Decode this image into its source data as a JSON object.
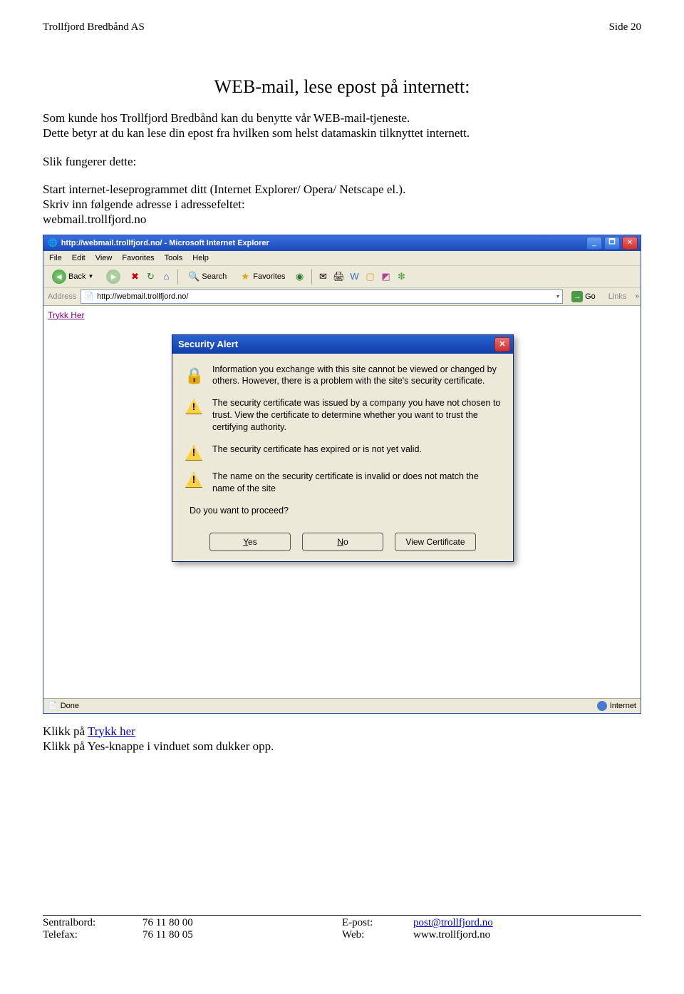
{
  "header": {
    "left": "Trollfjord Bredbånd AS",
    "right": "Side 20"
  },
  "title": "WEB-mail, lese epost på internett:",
  "paragraphs": {
    "intro": "Som kunde hos Trollfjord Bredbånd kan du benytte vår WEB-mail-tjeneste.\nDette betyr at du kan lese din epost fra hvilken som helst datamaskin tilknyttet internett.",
    "sub": "Slik fungerer dette:",
    "instr1": "Start internet-leseprogrammet ditt (Internet Explorer/ Opera/ Netscape el.).",
    "instr2": "Skriv inn følgende adresse i adressefeltet:",
    "addr": "webmail.trollfjord.no",
    "after1_pre": "Klikk på ",
    "after1_link": "Trykk her",
    "after2": "Klikk på Yes-knappe i vinduet som dukker opp."
  },
  "browser": {
    "title": "http://webmail.trollfjord.no/ - Microsoft Internet Explorer",
    "menu": [
      "File",
      "Edit",
      "View",
      "Favorites",
      "Tools",
      "Help"
    ],
    "back": "Back",
    "search": "Search",
    "favorites": "Favorites",
    "address_label": "Address",
    "address_value": "http://webmail.trollfjord.no/",
    "go": "Go",
    "links": "Links",
    "trykk": "Trykk Her",
    "status_done": "Done",
    "status_zone": "Internet"
  },
  "dialog": {
    "title": "Security Alert",
    "msg1": "Information you exchange with this site cannot be viewed or changed by others. However, there is a problem with the site's security certificate.",
    "msg2": "The security certificate was issued by a company you have not chosen to trust. View the certificate to determine whether you want to trust the certifying authority.",
    "msg3": "The security certificate has expired or is not yet valid.",
    "msg4": "The name on the security certificate is invalid or does not match the name of the site",
    "proceed": "Do you want to proceed?",
    "yes": "Yes",
    "no": "No",
    "view": "View Certificate"
  },
  "footer": {
    "sentralbord_label": "Sentralbord:",
    "sentralbord_val": "76 11 80 00",
    "telefax_label": "Telefax:",
    "telefax_val": "76 11 80 05",
    "epost_label": "E-post:",
    "epost_val": "post@trollfjord.no",
    "web_label": "Web:",
    "web_val": "www.trollfjord.no"
  }
}
